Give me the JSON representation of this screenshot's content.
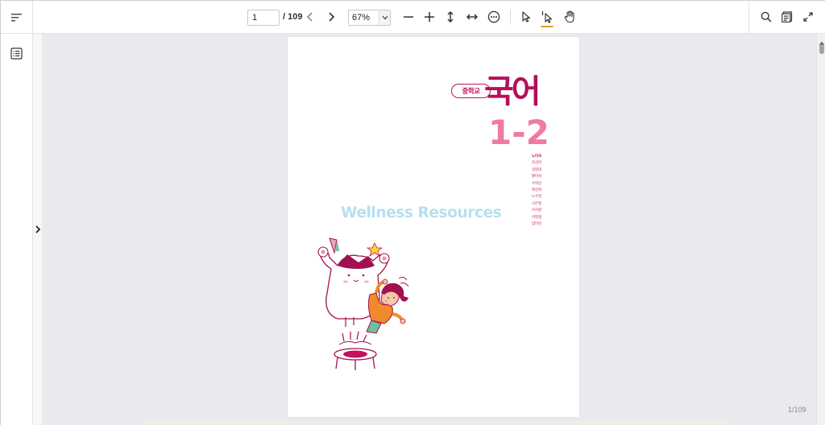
{
  "toolbar": {
    "page_current": "1",
    "page_total": "/ 109",
    "zoom_value": "67%",
    "icons": {
      "menu": "menu-lines-icon",
      "prev": "chevron-left-icon",
      "next": "chevron-right-icon",
      "zoom_out": "minus-icon",
      "zoom_in": "plus-icon",
      "fit_height": "fit-height-icon",
      "fit_width": "fit-width-icon",
      "more": "more-options-icon",
      "select": "pointer-icon",
      "text_select": "text-select-icon",
      "pan": "hand-icon",
      "search": "search-icon",
      "thumbnails": "thumbnails-icon",
      "fullscreen": "expand-icon"
    },
    "active_tool_color": "#e89a2c"
  },
  "sidebar": {
    "icons": {
      "toc": "table-of-contents-icon",
      "expand": "chevron-right-icon"
    }
  },
  "document": {
    "cover": {
      "school_level": "중학교",
      "subject": "국어",
      "grade": "1-2",
      "authors": [
        "노미숙",
        "조선아",
        "김현대",
        "황미숙",
        "수학선",
        "최선희",
        "노수연",
        "고은정",
        "이지원",
        "이연정",
        "임미진"
      ],
      "watermark": "Wellness Resources",
      "colors": {
        "primary": "#b3105a",
        "accent": "#ef7aa3",
        "watermark": "#b6dff0"
      }
    },
    "page_counter": "1/109"
  }
}
